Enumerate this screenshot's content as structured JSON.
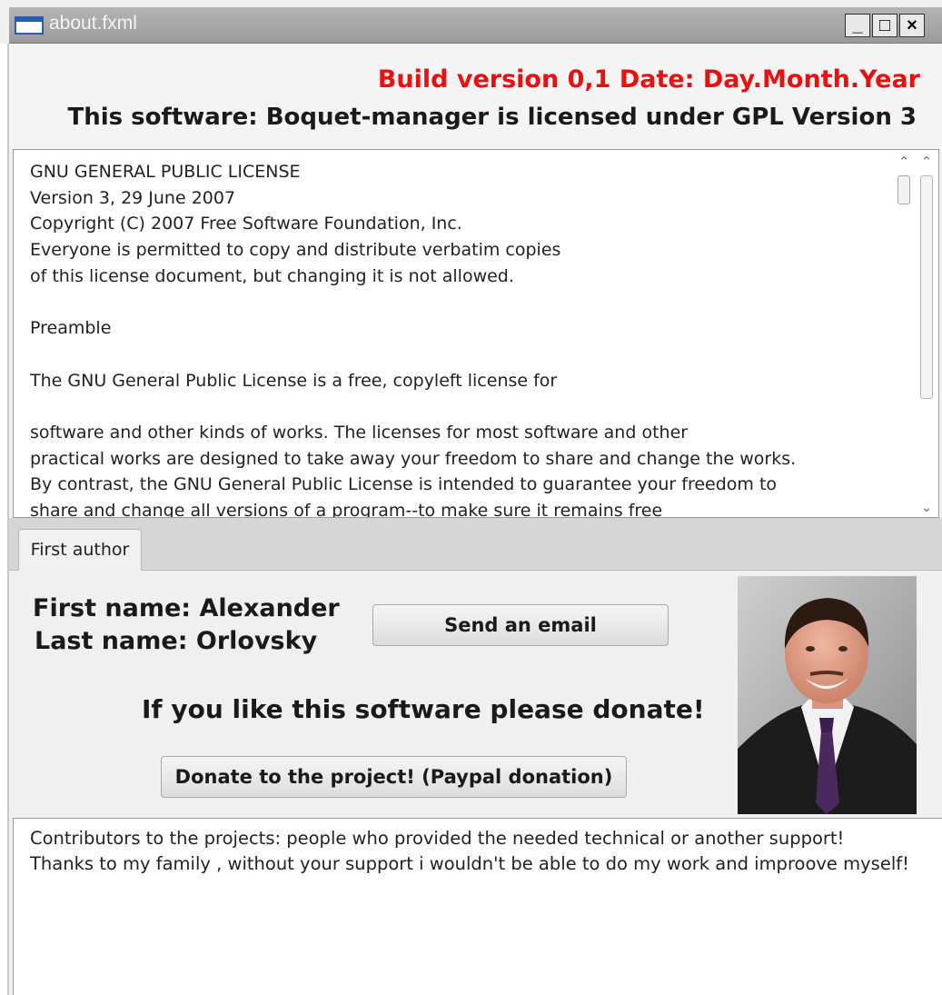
{
  "window": {
    "title": "about.fxml",
    "minimize_label": "_",
    "maximize_label": "□",
    "close_label": "×"
  },
  "header": {
    "build_info": "Build version 0,1 Date: Day.Month.Year",
    "license_statement": "This software: Boquet-manager is licensed under GPL Version 3"
  },
  "license": {
    "lines": [
      "GNU GENERAL PUBLIC LICENSE",
      "Version 3, 29 June 2007",
      "Copyright (C) 2007 Free Software Foundation, Inc.",
      "Everyone is permitted to copy and distribute verbatim copies",
      "of this license document, but changing it is not allowed.",
      "",
      "Preamble",
      "",
      "The GNU General Public License is a free, copyleft license for",
      "",
      "software and other kinds of works. The licenses for most software and other",
      "practical works are designed to take away your freedom to share and change the works.",
      "By contrast, the GNU General Public License is intended to guarantee your freedom to",
      "share and change all versions of a program--to make sure it remains free"
    ]
  },
  "tabs": [
    {
      "label": "First author"
    }
  ],
  "author": {
    "first_name": "First name: Alexander",
    "last_name": "Last name: Orlovsky",
    "email_button": "Send an email",
    "donate_heading": "If you like this software please donate!",
    "donate_button": "Donate to the project! (Paypal donation)"
  },
  "contributors": {
    "lines": [
      "Contributors to the projects: people who provided the needed technical or another support!",
      "Thanks to my family , without your support i wouldn't be able to do my work and improove myself!"
    ]
  },
  "colors": {
    "build_info": "#e81010",
    "tie": "#4a2a5e"
  }
}
